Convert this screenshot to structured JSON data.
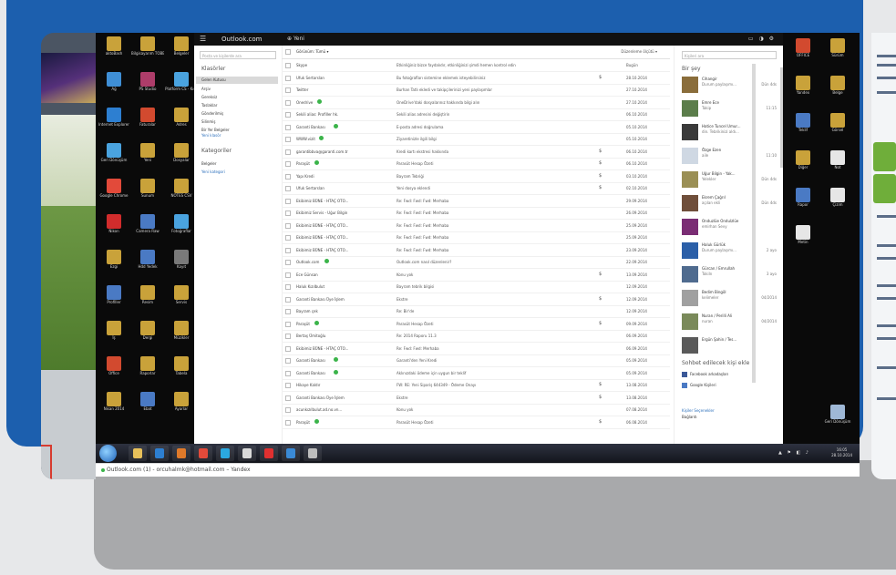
{
  "browser_status": "Outlook.com (1) - orcuhalmk@hotmail.com – Yandex",
  "outlook": {
    "brand": "Outlook.com",
    "new_label": "Yeni",
    "search_placeholder": "Posta ve kişilerde ara",
    "folders_header": "Klasörler",
    "folders": [
      "Gelen Kutusu",
      "Arşiv",
      "Gereksiz",
      "Taslaklar",
      "Gönderilmiş",
      "Silinmiş",
      "Bir Yer Belgeler"
    ],
    "new_folder": "Yeni klasör",
    "categories_header": "Kategoriler",
    "categories": [
      "Belgeler"
    ],
    "new_category": "Yeni kategori",
    "list_header": "Görünüm: Tümü ▾",
    "sort_label": "Düzenleme ölçütü ▾",
    "rows": [
      {
        "sender": "Skype",
        "subject": "Etkinliğiniz bizce faydalıdır, etkinliğinizi şimdi hemen kontrol edin",
        "date": "Bugün",
        "online": false,
        "attach": false
      },
      {
        "sender": "Ufuk Sertarslan",
        "subject": "Bu fotoğrafları sistemine eklemek isteyebilirsiniz",
        "date": "28.10.2014",
        "online": false,
        "attach": true
      },
      {
        "sender": "Twitter",
        "subject": "Burhan Tatlı ekledi ve takipçilerinizi yeni paylaşımlar",
        "date": "27.10.2014",
        "online": false,
        "attach": false
      },
      {
        "sender": "Onedrive",
        "subject": "OneDrive'daki dosyalarınız hakkında bilgi alın",
        "date": "27.10.2014",
        "online": true,
        "attach": false
      },
      {
        "sender": "Sekili alias: Profiller hk.",
        "subject": "Sekili alias adresini değiştirin",
        "date": "06.10.2014",
        "online": false,
        "attach": false
      },
      {
        "sender": "Garanti Bankası",
        "subject": "E-posta adresi doğrulama",
        "date": "05.10.2014",
        "online": true,
        "attach": false
      },
      {
        "sender": "WWW.vizit",
        "subject": "Ziyaretinizle ilgili bilgi",
        "date": "05.10.2014",
        "online": true,
        "attach": false
      },
      {
        "sender": "garantibbva@garanti.com.tr",
        "subject": "Kredi kartı ekstresi hakkında",
        "date": "06.10.2014",
        "online": false,
        "attach": true
      },
      {
        "sender": "Paraşüt",
        "subject": "Parasüt Hesap Özeti",
        "date": "06.10.2014",
        "online": true,
        "attach": true
      },
      {
        "sender": "Yapı Kredi",
        "subject": "Bayram Tebriği",
        "date": "03.10.2014",
        "online": false,
        "attach": true
      },
      {
        "sender": "Ufuk Sertarslan",
        "subject": "Yeni dosya eklendi",
        "date": "02.10.2014",
        "online": false,
        "attach": true
      },
      {
        "sender": "Ekibimiz BÜNE - HTAÇ OTO...",
        "subject": "Re: Fwd: Fwd: Fwd: Merhaba",
        "date": "29.09.2014",
        "online": false,
        "attach": false
      },
      {
        "sender": "Ekibimiz Servis - Uğur Bilgin",
        "subject": "Re: Fwd: Fwd: Fwd: Merhaba",
        "date": "26.09.2014",
        "online": false,
        "attach": false
      },
      {
        "sender": "Ekibimiz BÜNE - HTAÇ OTO...",
        "subject": "Re: Fwd: Fwd: Fwd: Merhaba",
        "date": "25.09.2014",
        "online": false,
        "attach": false
      },
      {
        "sender": "Ekibimiz BÜNE - HTAÇ OTO...",
        "subject": "Re: Fwd: Fwd: Fwd: Merhaba",
        "date": "25.09.2014",
        "online": false,
        "attach": false
      },
      {
        "sender": "Ekibimiz BÜNE - HTAÇ OTO...",
        "subject": "Re: Fwd: Fwd: Fwd: Merhaba",
        "date": "23.09.2014",
        "online": false,
        "attach": false
      },
      {
        "sender": "Outlook.com",
        "subject": "Outlook.com nasıl düzenlenir?",
        "date": "22.09.2014",
        "online": true,
        "attach": false
      },
      {
        "sender": "Ece Günsan",
        "subject": "Konu yok",
        "date": "13.09.2014",
        "online": false,
        "attach": true
      },
      {
        "sender": "Haluk Kızılbulut",
        "subject": "Bayram tebrik bilgisi",
        "date": "12.09.2014",
        "online": false,
        "attach": false
      },
      {
        "sender": "Garanti Bankası Üye İşlem",
        "subject": "Ekstre",
        "date": "12.09.2014",
        "online": false,
        "attach": true
      },
      {
        "sender": "Bayram çek",
        "subject": "Re: Bir'de",
        "date": "12.09.2014",
        "online": false,
        "attach": false
      },
      {
        "sender": "Paraşüt",
        "subject": "Parasüt Hesap Özeti",
        "date": "09.09.2014",
        "online": true,
        "attach": true
      },
      {
        "sender": "Bertaş Ümitoğlu",
        "subject": "Re: 2014 Raporu 11.3",
        "date": "06.09.2014",
        "online": false,
        "attach": false
      },
      {
        "sender": "Ekibimiz BÜNE - HTAÇ OTO...",
        "subject": "Re: Fwd: Fwd: Merhaba",
        "date": "06.09.2014",
        "online": false,
        "attach": false
      },
      {
        "sender": "Garanti Bankası",
        "subject": "Garanti'den Yeni Kredi",
        "date": "05.09.2014",
        "online": true,
        "attach": false
      },
      {
        "sender": "Garanti Bankası",
        "subject": "Aklınızdaki ödeme için uygun bir teklif",
        "date": "05.09.2014",
        "online": true,
        "attach": false
      },
      {
        "sender": "Hikaye Kaldır",
        "subject": "FW: RE: Yeni Sipariş 644349 - Ödeme Onayı",
        "date": "13.08.2014",
        "online": false,
        "attach": true
      },
      {
        "sender": "Garanti Bankası Üye İşlem",
        "subject": "Ekstre",
        "date": "13.08.2014",
        "online": false,
        "attach": true
      },
      {
        "sender": "acunkızılbulut.ad.no.vn...",
        "subject": "Konu yok",
        "date": "07.08.2014",
        "online": false,
        "attach": false
      },
      {
        "sender": "Paraşüt",
        "subject": "Parasüt Hesap Özeti",
        "date": "06.08.2014",
        "online": true,
        "attach": true
      }
    ],
    "people": {
      "search_placeholder": "Kişileri ara",
      "title": "Bir şey",
      "items": [
        {
          "name": "Cihangir",
          "status": "Durum paylaşımı...",
          "time": "Dün 4ds",
          "color": "#8a6d3b"
        },
        {
          "name": "Emre Ece",
          "status": "Takip",
          "time": "11:15",
          "color": "#5b7d4a"
        },
        {
          "name": "Hatice Tuncel Umur...",
          "status": "din. Tebrikinizi aldı...",
          "time": "",
          "color": "#3a3a3a"
        },
        {
          "name": "Özge Ezen",
          "status": "aile",
          "time": "11:10",
          "color": "#cfd8e3"
        },
        {
          "name": "Uğur Bilgin - Yak...",
          "status": "Yelekler",
          "time": "Dün 4ds",
          "color": "#9a8f55"
        },
        {
          "name": "Ekrem Çağrıl",
          "status": "açılan ekli",
          "time": "Dün 4ds",
          "color": "#6f4e3a"
        },
        {
          "name": "Onduzlüe Ondulzlüe",
          "status": "emirhan Sevy",
          "time": "",
          "color": "#7a2d74"
        },
        {
          "name": "Haluk Gürlük",
          "status": "Durum paylaşımı...",
          "time": "2 ayo",
          "color": "#2b5fa8"
        },
        {
          "name": "Gürcan / Emrullah",
          "status": "Tokiln",
          "time": "3 ayo",
          "color": "#4f6b8f"
        },
        {
          "name": "Bedim Bingöl",
          "status": "kelimeler",
          "time": "04/2014",
          "color": "#a0a0a0"
        },
        {
          "name": "Nuran / Perilli Ali",
          "status": "nuran",
          "time": "04/2014",
          "color": "#7a8a5a"
        },
        {
          "name": "Ergün Şahin / Tes...",
          "status": "",
          "time": "",
          "color": "#5a5a5a"
        }
      ],
      "chat_header": "Sohbet edilecek kişi ekle",
      "chat_links": [
        "Facebook arkadaşları",
        "Google Kişileri"
      ],
      "bottom_link": "Kişiler Seçenekler",
      "bottom_sub": "Bağlantı"
    }
  },
  "desktop": {
    "left_icons": [
      {
        "label": "aktoBash",
        "color": "#c9a23a"
      },
      {
        "label": "Bilgisayarım TOBB",
        "color": "#c9a23a"
      },
      {
        "label": "Belgeler",
        "color": "#c9a23a"
      },
      {
        "label": "Ağ",
        "color": "#3f8fd6"
      },
      {
        "label": "PS Studio",
        "color": "#ad3d6a"
      },
      {
        "label": "Platform CS - Kısa",
        "color": "#4aa3df"
      },
      {
        "label": "Internet Explorer",
        "color": "#2d7fd1"
      },
      {
        "label": "Faturalar",
        "color": "#d24a2f"
      },
      {
        "label": "Adres",
        "color": "#c9a23a"
      },
      {
        "label": "Geri Dönüşüm",
        "color": "#4aa3df"
      },
      {
        "label": "Yeni",
        "color": "#c9a23a"
      },
      {
        "label": "Dosyalar",
        "color": "#c9a23a"
      },
      {
        "label": "Google Chrome",
        "color": "#e24a3a"
      },
      {
        "label": "Sunum",
        "color": "#c9a23a"
      },
      {
        "label": "NOTES CSV",
        "color": "#c9a23a"
      },
      {
        "label": "Nikon",
        "color": "#d12c2c"
      },
      {
        "label": "Camera Raw",
        "color": "#4a7ac4"
      },
      {
        "label": "Fotoğraflar",
        "color": "#4aa3df"
      },
      {
        "label": "Ezgi",
        "color": "#c9a23a"
      },
      {
        "label": "Hdd Yedek",
        "color": "#4a7ac4"
      },
      {
        "label": "Kayıt",
        "color": "#7a7a7a"
      },
      {
        "label": "Profiller",
        "color": "#4a7ac4"
      },
      {
        "label": "Resim",
        "color": "#c9a23a"
      },
      {
        "label": "Servis",
        "color": "#c9a23a"
      },
      {
        "label": "İş",
        "color": "#c9a23a"
      },
      {
        "label": "Dergi",
        "color": "#c9a23a"
      },
      {
        "label": "Müzikler",
        "color": "#c9a23a"
      },
      {
        "label": "Office",
        "color": "#d24a2f"
      },
      {
        "label": "Raporlar",
        "color": "#c9a23a"
      },
      {
        "label": "Tabela",
        "color": "#c9a23a"
      },
      {
        "label": "Nisan 2014",
        "color": "#c9a23a"
      },
      {
        "label": "Ebat",
        "color": "#4a7ac4"
      },
      {
        "label": "Ayarlar",
        "color": "#c9a23a"
      }
    ],
    "right_icons": [
      {
        "label": "OFFICE",
        "color": "#d24a2f"
      },
      {
        "label": "Sürüm",
        "color": "#c9a23a"
      },
      {
        "label": "Yandex",
        "color": "#c9a23a"
      },
      {
        "label": "Belge",
        "color": "#c9a23a"
      },
      {
        "label": "Teklif",
        "color": "#4a7ac4"
      },
      {
        "label": "Görsel",
        "color": "#c9a23a"
      },
      {
        "label": "Diğer",
        "color": "#c9a23a"
      },
      {
        "label": "Not",
        "color": "#e6e6e6"
      },
      {
        "label": "Rapor",
        "color": "#4a7ac4"
      },
      {
        "label": "Çizim",
        "color": "#e6e6e6"
      },
      {
        "label": "Metin",
        "color": "#e6e6e6"
      }
    ],
    "recycle_label": "Geri Dönüşüm"
  },
  "taskbar": {
    "buttons": [
      {
        "name": "explorer-button",
        "color": "#e7c05a"
      },
      {
        "name": "ie-button",
        "color": "#2d7fd1"
      },
      {
        "name": "media-button",
        "color": "#e07a2a"
      },
      {
        "name": "chrome-button",
        "color": "#e24a3a"
      },
      {
        "name": "skype-button",
        "color": "#2ba8e0"
      },
      {
        "name": "folder-button",
        "color": "#d9d9d9"
      },
      {
        "name": "yandex-button",
        "color": "#e03030"
      },
      {
        "name": "ie2-button",
        "color": "#3a8ad6"
      },
      {
        "name": "window-button",
        "color": "#bdbdbd"
      }
    ],
    "tray": "▲ ⚑ ◧ ♪",
    "time": "16:05",
    "date": "28.10.2014"
  },
  "colors": {
    "blue_panel": "#1c5fae",
    "grey_panel": "#a8a9ab",
    "online": "#3bb44a"
  }
}
